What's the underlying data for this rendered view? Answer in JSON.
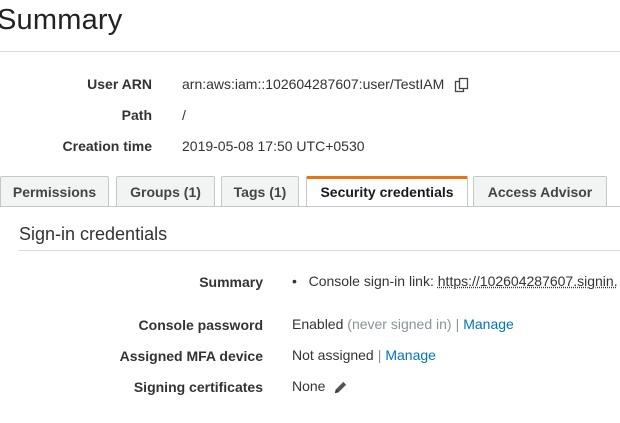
{
  "header": {
    "title": "Summary"
  },
  "user_info": {
    "user_arn_label": "User ARN",
    "user_arn": "arn:aws:iam::102604287607:user/TestIAM",
    "path_label": "Path",
    "path": "/",
    "creation_time_label": "Creation time",
    "creation_time": "2019-05-08 17:50 UTC+0530",
    "copy_icon": "copy-icon"
  },
  "tabs": [
    {
      "label": "Permissions",
      "active": false
    },
    {
      "label": "Groups (1)",
      "active": false
    },
    {
      "label": "Tags (1)",
      "active": false
    },
    {
      "label": "Security credentials",
      "active": true
    },
    {
      "label": "Access Advisor",
      "active": false
    }
  ],
  "signin": {
    "title": "Sign-in credentials",
    "summary_label": "Summary",
    "summary_text": "Console sign-in link:",
    "summary_link": "https://102604287607.signin.",
    "console_password_label": "Console password",
    "console_password_status": "Enabled",
    "console_password_note": "(never signed in)",
    "manage_label": "Manage",
    "mfa_label": "Assigned MFA device",
    "mfa_status": "Not assigned",
    "signing_label": "Signing certificates",
    "signing_value": "None",
    "separator": "|",
    "bullet": "•"
  },
  "colors": {
    "accent": "#ec7211",
    "link": "#0073bb",
    "muted": "#879596"
  }
}
